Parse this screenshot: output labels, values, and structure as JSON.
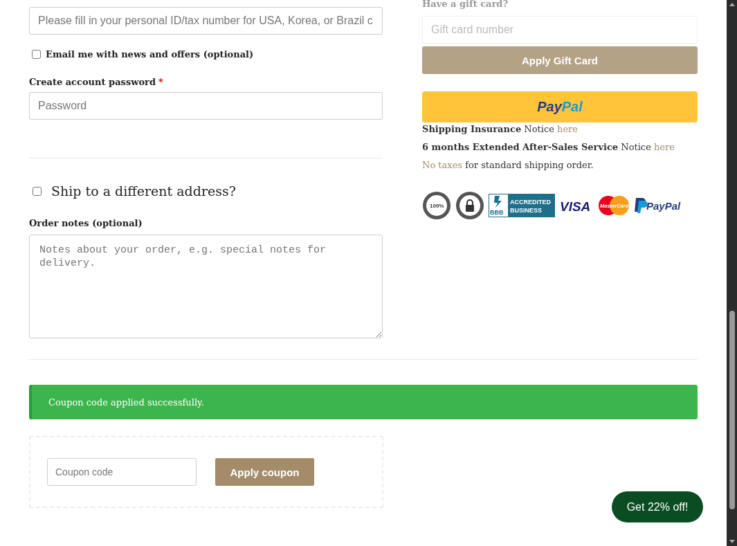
{
  "tax_field": {
    "placeholder": "Please fill in your personal ID/tax number for USA, Korea, or Brazil c"
  },
  "newsletter": {
    "label": "Email me with news and offers (optional)",
    "checked": false
  },
  "password": {
    "label": "Create account password",
    "required_mark": "*",
    "placeholder": "Password"
  },
  "ship_different": {
    "label": "Ship to a different address?",
    "checked": false
  },
  "order_notes": {
    "label": "Order notes (optional)",
    "placeholder": "Notes about your order, e.g. special notes for delivery."
  },
  "gift_card": {
    "heading": "Have a gift card?",
    "placeholder": "Gift card number",
    "button": "Apply Gift Card",
    "disabled": true
  },
  "paypal_button": {
    "logo": [
      "Pay",
      "Pal"
    ]
  },
  "notices": [
    {
      "parts": [
        {
          "kind": "text",
          "text": "**Shipping Insurance** Notice"
        },
        {
          "kind": "link",
          "text": "here"
        }
      ]
    },
    {
      "parts": [
        {
          "kind": "text",
          "text": "**6 months Extended After-Sales Service** Notice"
        },
        {
          "kind": "link",
          "text": "here"
        }
      ]
    },
    {
      "parts": [
        {
          "kind": "link",
          "text": "No taxes"
        },
        {
          "kind": "text",
          "text": "for standard shipping order."
        }
      ]
    }
  ],
  "badges": [
    {
      "kind": "seal-100",
      "text": "100%"
    },
    {
      "kind": "seal-lock"
    },
    {
      "kind": "bbb",
      "text": "BBB",
      "caption": "ACCREDITED BUSINESS"
    },
    {
      "kind": "visa",
      "text": "VISA"
    },
    {
      "kind": "mastercard",
      "text": "MasterCard"
    },
    {
      "kind": "paypal",
      "text": "PayPal"
    }
  ],
  "success_message": "Coupon code applied successfully.",
  "coupon": {
    "placeholder": "Coupon code",
    "button": "Apply coupon"
  },
  "promo_button": "Get 22% off!"
}
